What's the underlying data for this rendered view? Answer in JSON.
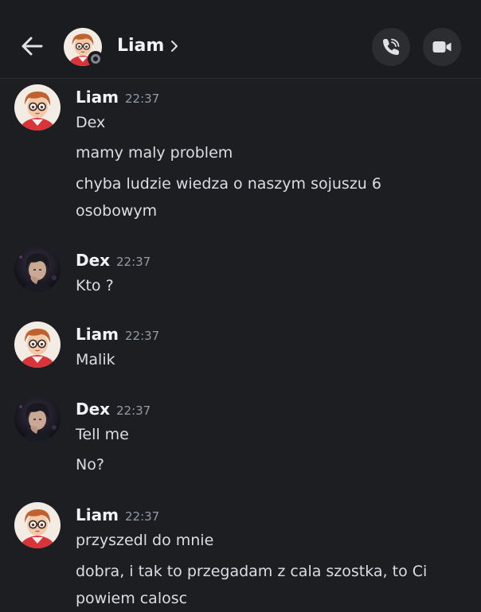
{
  "header": {
    "name": "Liam",
    "back_icon": "arrow-left-icon",
    "chevron_icon": "chevron-right-icon",
    "call_icon": "phone-call-icon",
    "video_icon": "video-camera-icon",
    "status": "offline"
  },
  "messages": [
    {
      "author": "Liam",
      "time": "22:37",
      "lines": [
        "Dex",
        "mamy maly problem",
        "chyba ludzie wiedza o naszym sojuszu 6 osobowym"
      ]
    },
    {
      "author": "Dex",
      "time": "22:37",
      "lines": [
        "Kto ?"
      ]
    },
    {
      "author": "Liam",
      "time": "22:37",
      "lines": [
        "Malik"
      ]
    },
    {
      "author": "Dex",
      "time": "22:37",
      "lines": [
        "Tell me",
        "No?"
      ]
    },
    {
      "author": "Liam",
      "time": "22:37",
      "lines": [
        "przyszedl do mnie",
        "dobra, i tak to przegadam z cala szostka, to Ci powiem calosc"
      ]
    }
  ],
  "colors": {
    "background": "#1d1e22",
    "header_background": "#1b1c20",
    "button_background": "#2b2d31",
    "text": "#dcdde2",
    "timestamp": "#949ba4",
    "status_offline": "#80848e"
  }
}
